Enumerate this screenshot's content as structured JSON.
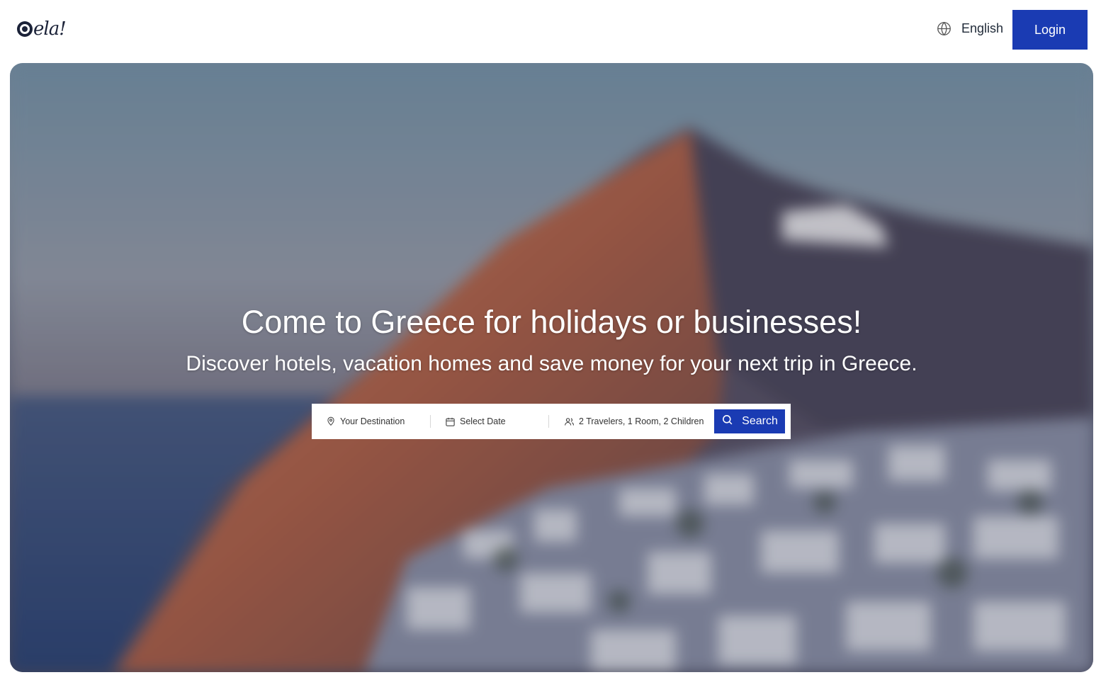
{
  "header": {
    "logo_text": "ela!",
    "language_label": "English",
    "login_label": "Login"
  },
  "hero": {
    "title": "Come to Greece for holidays or businesses!",
    "subtitle": "Discover hotels, vacation homes and save money for your next trip in Greece."
  },
  "search": {
    "destination_placeholder": "Your Destination",
    "date_placeholder": "Select Date",
    "travelers_value": "2 Travelers, 1 Room, 2 Children",
    "button_label": "Search"
  },
  "icons": {
    "logo": "eye-logo-icon",
    "language": "globe-icon",
    "destination": "map-pin-icon",
    "date": "calendar-icon",
    "travelers": "users-icon",
    "search": "search-icon"
  },
  "colors": {
    "primary": "#1a3bb3",
    "logo": "#1b2238",
    "text": "#1f2937"
  }
}
